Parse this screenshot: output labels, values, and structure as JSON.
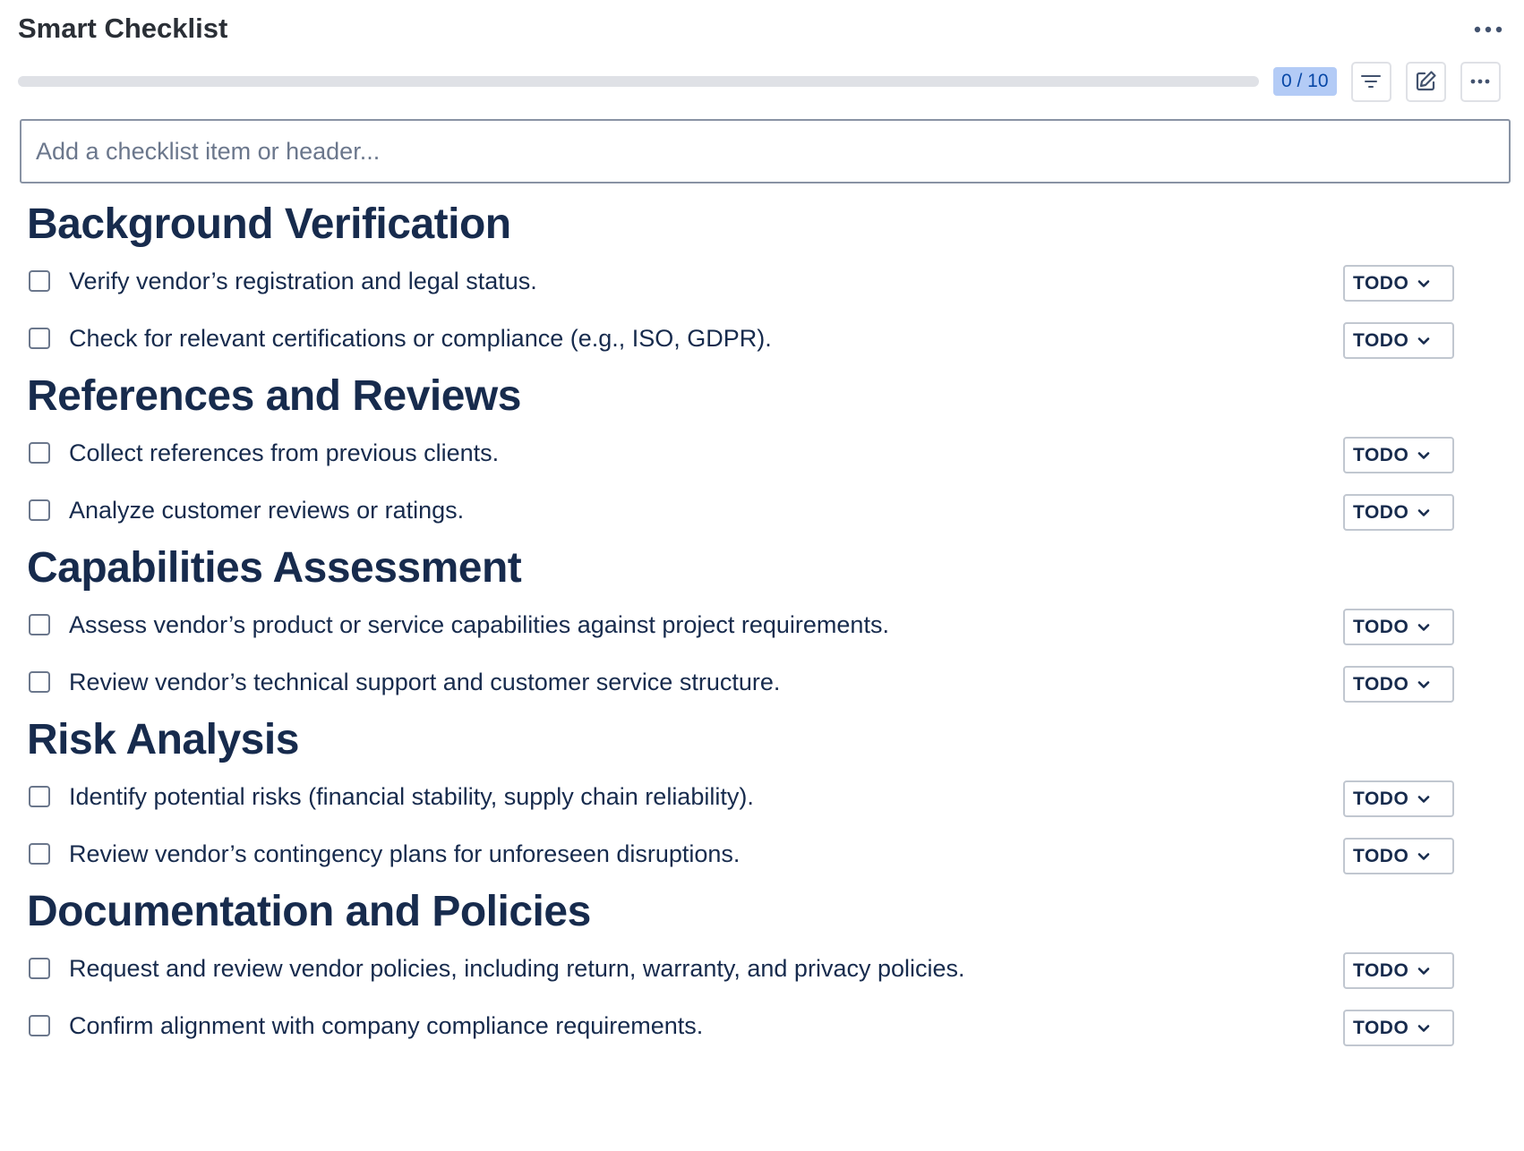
{
  "header": {
    "title": "Smart Checklist",
    "count": "0 / 10",
    "progress_fraction": 0,
    "icons": [
      "more-horizontal-icon",
      "filter-icon",
      "edit-icon",
      "more-horizontal-icon"
    ]
  },
  "input": {
    "placeholder": "Add a checklist item or header..."
  },
  "status_label": "TODO",
  "sections": [
    {
      "title": "Background Verification",
      "items": [
        "Verify vendor’s registration and legal status.",
        "Check for relevant certifications or compliance (e.g., ISO, GDPR)."
      ]
    },
    {
      "title": "References and Reviews",
      "items": [
        "Collect references from previous clients.",
        "Analyze customer reviews or ratings."
      ]
    },
    {
      "title": "Capabilities Assessment",
      "items": [
        "Assess vendor’s product or service capabilities against project requirements.",
        "Review vendor’s technical support and customer service structure."
      ]
    },
    {
      "title": "Risk Analysis",
      "items": [
        "Identify potential risks (financial stability, supply chain reliability).",
        "Review vendor’s contingency plans for unforeseen disruptions."
      ]
    },
    {
      "title": "Documentation and Policies",
      "items": [
        "Request and review vendor policies, including return, warranty, and privacy policies.",
        "Confirm alignment with company compliance requirements."
      ]
    }
  ],
  "colors": {
    "text": "#172b4d",
    "badge_bg": "#b3cbf6",
    "badge_text": "#0747a6",
    "track": "#dfe1e6"
  }
}
